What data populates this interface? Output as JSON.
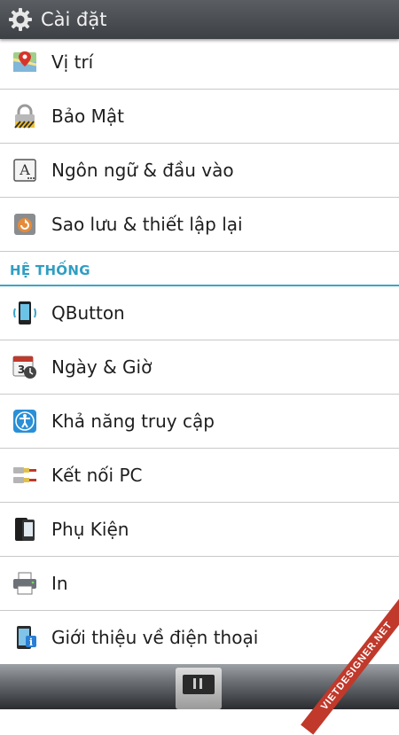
{
  "header": {
    "title": "Cài đặt",
    "icon": "gear-icon"
  },
  "items_top": [
    {
      "id": "location",
      "label": "Vị trí",
      "icon": "map-pin-icon"
    },
    {
      "id": "security",
      "label": "Bảo Mật",
      "icon": "lock-icon"
    },
    {
      "id": "language",
      "label": "Ngôn ngữ & đầu vào",
      "icon": "language-icon"
    },
    {
      "id": "backup",
      "label": "Sao lưu & thiết lập lại",
      "icon": "backup-reset-icon"
    }
  ],
  "section": {
    "label": "HỆ THỐNG",
    "color": "#2f9ec2"
  },
  "items_system": [
    {
      "id": "qbutton",
      "label": "QButton",
      "icon": "qbutton-icon"
    },
    {
      "id": "datetime",
      "label": "Ngày & Giờ",
      "icon": "calendar-clock-icon"
    },
    {
      "id": "accessibility",
      "label": "Khả năng truy cập",
      "icon": "accessibility-icon"
    },
    {
      "id": "pc-connection",
      "label": "Kết nối PC",
      "icon": "cable-connector-icon"
    },
    {
      "id": "accessories",
      "label": "Phụ Kiện",
      "icon": "phone-accessory-icon"
    },
    {
      "id": "print",
      "label": "In",
      "icon": "printer-icon"
    },
    {
      "id": "about-phone",
      "label": "Giới thiệu về điện thoại",
      "icon": "phone-info-icon"
    }
  ],
  "watermark": "VIETDESIGNER.NET"
}
